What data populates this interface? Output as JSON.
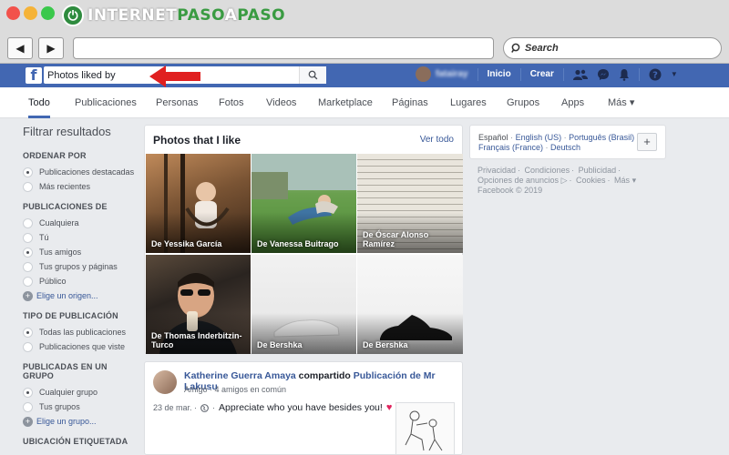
{
  "browser": {
    "logo_text_1": "INTERNET",
    "logo_text_2": "PASO",
    "logo_text_3": "A",
    "logo_text_4": "PASO",
    "back_icon": "back-arrow-icon",
    "forward_icon": "forward-arrow-icon",
    "url_value": "",
    "search_label": "Search"
  },
  "fb": {
    "logo_letter": "f",
    "search_value": "Photos liked by",
    "user_name": "fatairay",
    "nav": [
      "Inicio",
      "Crear"
    ]
  },
  "tabs": [
    "Todo",
    "Publicaciones",
    "Personas",
    "Fotos",
    "Videos",
    "Marketplace",
    "Páginas",
    "Lugares",
    "Grupos",
    "Apps",
    "Más ▾"
  ],
  "sidebar": {
    "title": "Filtrar resultados",
    "groups": [
      {
        "heading": "ORDENAR POR",
        "options": [
          "Publicaciones destacadas",
          "Más recientes"
        ],
        "selected": 0,
        "link": ""
      },
      {
        "heading": "PUBLICACIONES DE",
        "options": [
          "Cualquiera",
          "Tú",
          "Tus amigos",
          "Tus grupos y páginas",
          "Público"
        ],
        "selected": 2,
        "link": "Elige un origen..."
      },
      {
        "heading": "TIPO DE PUBLICACIÓN",
        "options": [
          "Todas las publicaciones",
          "Publicaciones que viste"
        ],
        "selected": 0,
        "link": ""
      },
      {
        "heading": "PUBLICADAS EN UN GRUPO",
        "options": [
          "Cualquier grupo",
          "Tus grupos"
        ],
        "selected": 0,
        "link": "Elige un grupo..."
      },
      {
        "heading": "UBICACIÓN ETIQUETADA",
        "options": [],
        "selected": -1,
        "link": ""
      }
    ]
  },
  "photos": {
    "title": "Photos that I like",
    "see_all": "Ver todo",
    "tiles": [
      {
        "caption": "De Yessika García"
      },
      {
        "caption": "De Vanessa Buitrago"
      },
      {
        "caption": "De Óscar Alonso Ramírez"
      },
      {
        "caption": "De Thomas Inderbitzin-Turco"
      },
      {
        "caption": "De Bershka"
      },
      {
        "caption": "De Bershka"
      }
    ]
  },
  "post": {
    "author": "Katherine Guerra Amaya",
    "verb": "compartido",
    "target": "Publicación de Mr Lakusu",
    "relation": "Amigo · 4 amigos en común",
    "date": "23 de mar. ·",
    "text": "Appreciate who you have besides you!"
  },
  "right": {
    "languages": [
      "Español",
      "English (US)",
      "Português (Brasil)",
      "Français (France)",
      "Deutsch"
    ],
    "footer_links": [
      "Privacidad",
      "Condiciones",
      "Publicidad",
      "Opciones de anuncios",
      "Cookies",
      "Más"
    ],
    "copyright": "Facebook © 2019"
  }
}
